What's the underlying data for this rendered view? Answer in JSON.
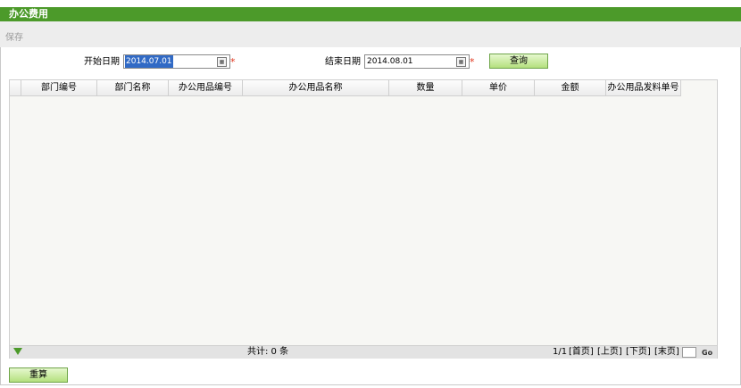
{
  "title": "办公费用",
  "toolbar": {
    "save_label": "保存"
  },
  "filters": {
    "start_label": "开始日期",
    "start_value": "2014.07.01",
    "end_label": "结束日期",
    "end_value": "2014.08.01",
    "required_mark": "*",
    "query_button": "查询"
  },
  "grid": {
    "columns": [
      "部门编号",
      "部门名称",
      "办公用品编号",
      "办公用品名称",
      "数量",
      "单价",
      "金额",
      "办公用品发料单号"
    ],
    "rows": [],
    "total_text": "共计: 0 条",
    "pager": {
      "page_info": "1/1",
      "first": "[首页]",
      "prev": "[上页]",
      "next": "[下页]",
      "last": "[末页]"
    }
  },
  "footer": {
    "recalc_button": "重算"
  },
  "colors": {
    "title_bar": "#4c9a2a",
    "accent_required": "#e2361d",
    "selection": "#316ac5"
  }
}
